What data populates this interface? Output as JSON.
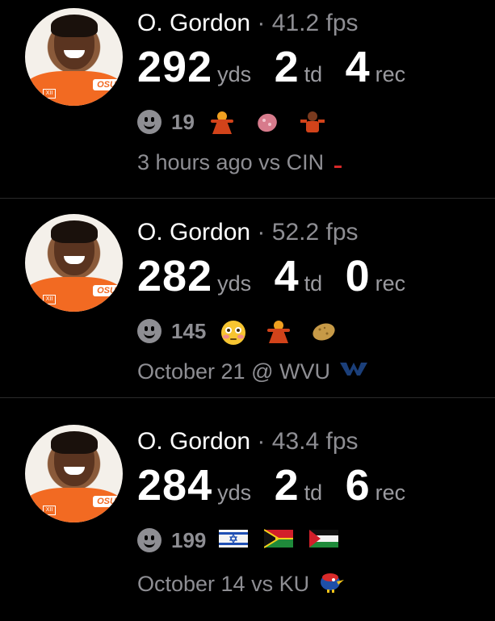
{
  "posts": [
    {
      "player": "O. Gordon",
      "separator": "·",
      "fps": "41.2 fps",
      "yds": "292",
      "yds_unit": "yds",
      "td": "2",
      "td_unit": "td",
      "rec": "4",
      "rec_unit": "rec",
      "reaction_count": "19",
      "reactions": [
        "man-dancing-emoji",
        "egg-emoji",
        "player-emoji"
      ],
      "meta": "3 hours ago vs CIN",
      "opponent_logo": "cin-logo-icon"
    },
    {
      "player": "O. Gordon",
      "separator": "·",
      "fps": "52.2 fps",
      "yds": "282",
      "yds_unit": "yds",
      "td": "4",
      "td_unit": "td",
      "rec": "0",
      "rec_unit": "rec",
      "reaction_count": "145",
      "reactions": [
        "flushed-face-emoji",
        "man-dancing-emoji",
        "potato-emoji"
      ],
      "meta": "October 21 @ WVU",
      "opponent_logo": "wvu-logo-icon"
    },
    {
      "player": "O. Gordon",
      "separator": "·",
      "fps": "43.4 fps",
      "yds": "284",
      "yds_unit": "yds",
      "td": "2",
      "td_unit": "td",
      "rec": "6",
      "rec_unit": "rec",
      "reaction_count": "199",
      "reactions": [
        "israel-flag-emoji",
        "vanuatu-flag-emoji",
        "palestine-flag-emoji"
      ],
      "meta": "October 14 vs KU",
      "opponent_logo": "ku-jayhawk-icon"
    }
  ],
  "colors": {
    "background": "#000000",
    "primary_text": "#ffffff",
    "secondary_text": "#8e8e93",
    "accent": "#f26a22"
  },
  "avatar_badge": {
    "team": "OSU",
    "patch": "XII"
  }
}
